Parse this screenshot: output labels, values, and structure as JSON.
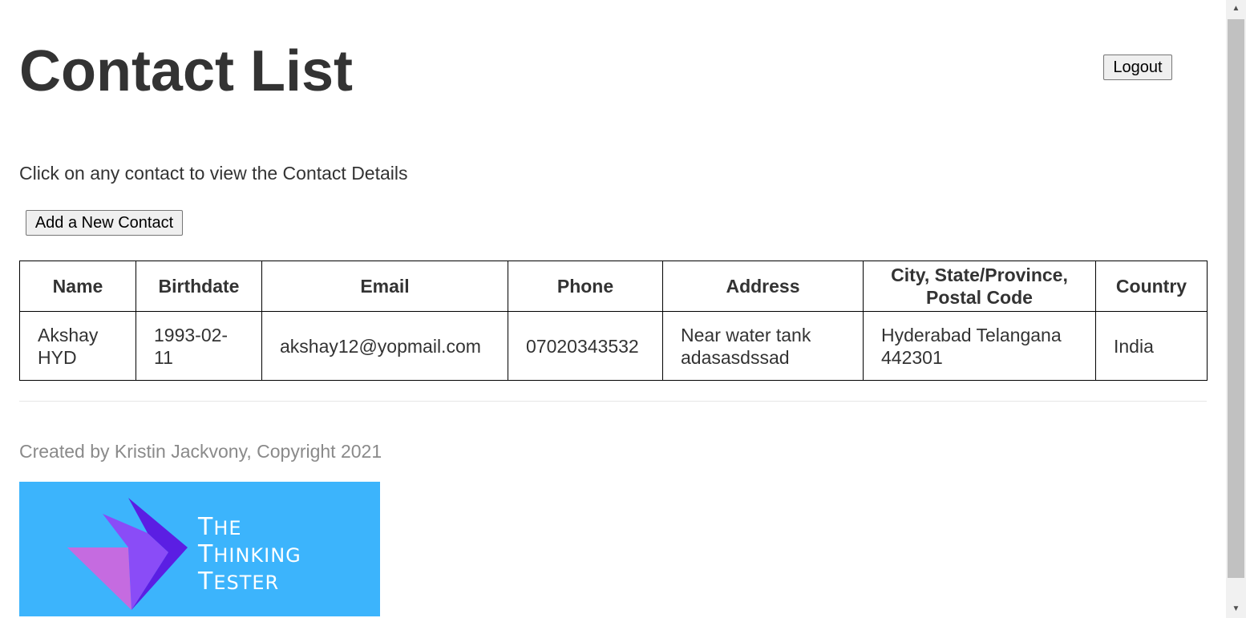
{
  "header": {
    "title": "Contact List",
    "logout_label": "Logout"
  },
  "main": {
    "instructions": "Click on any contact to view the Contact Details",
    "add_button_label": "Add a New Contact"
  },
  "table": {
    "headers": {
      "name": "Name",
      "birthdate": "Birthdate",
      "email": "Email",
      "phone": "Phone",
      "address": "Address",
      "city": "City, State/Province, Postal Code",
      "country": "Country"
    },
    "rows": [
      {
        "name": "Akshay HYD",
        "birthdate": "1993-02-11",
        "email": "akshay12@yopmail.com",
        "phone": "07020343532",
        "address": "Near water tank adasasdssad",
        "city": "Hyderabad Telangana 442301",
        "country": "India"
      }
    ]
  },
  "footer": {
    "credit": "Created by Kristin Jackvony, Copyright 2021",
    "logo_text": [
      "The",
      "Thinking",
      "Tester"
    ]
  },
  "colors": {
    "logo_background": "#3cb4fc",
    "text": "#333333",
    "footer_text": "#8a8a8a"
  },
  "icons": {
    "scroll_up": "triangle-up-icon",
    "scroll_down": "triangle-down-icon"
  }
}
